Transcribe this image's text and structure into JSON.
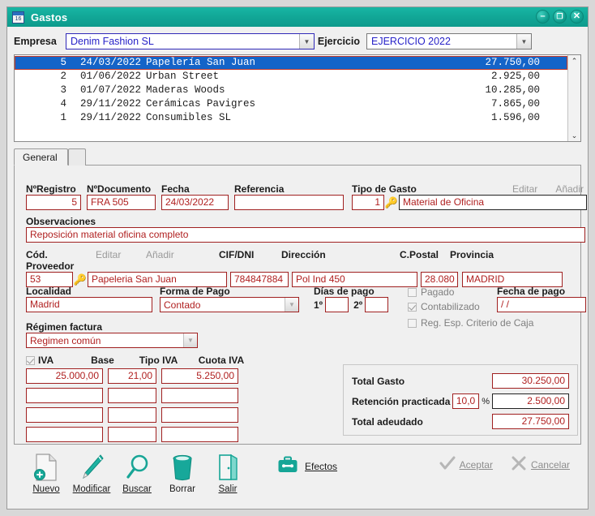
{
  "window": {
    "title": "Gastos",
    "icon": "calendar-16-icon",
    "icon_text": "16",
    "buttons": {
      "minimize": "–",
      "maximize": "❐",
      "close": "✕"
    }
  },
  "header": {
    "empresa_label": "Empresa",
    "empresa_value": "Denim Fashion SL",
    "ejercicio_label": "Ejercicio",
    "ejercicio_value": "EJERCICIO 2022"
  },
  "list": {
    "rows": [
      {
        "num": "5",
        "date": "24/03/2022",
        "name": "Papelería San Juan",
        "amount": "27.750,00",
        "selected": true
      },
      {
        "num": "2",
        "date": "01/06/2022",
        "name": "Urban Street",
        "amount": "2.925,00",
        "selected": false
      },
      {
        "num": "3",
        "date": "01/07/2022",
        "name": "Maderas Woods",
        "amount": "10.285,00",
        "selected": false
      },
      {
        "num": "4",
        "date": "29/11/2022",
        "name": "Cerámicas Pavigres",
        "amount": "7.865,00",
        "selected": false
      },
      {
        "num": "1",
        "date": "29/11/2022",
        "name": "Consumibles SL",
        "amount": "1.596,00",
        "selected": false
      }
    ],
    "scroll_up": "⌃",
    "scroll_down": "⌄"
  },
  "tabs": {
    "general": "General"
  },
  "form": {
    "nregistro_label": "NºRegistro",
    "nregistro_value": "5",
    "ndocumento_label": "NºDocumento",
    "ndocumento_value": "FRA 505",
    "fecha_label": "Fecha",
    "fecha_value": "24/03/2022",
    "referencia_label": "Referencia",
    "referencia_value": "",
    "tipogasto_label": "Tipo de Gasto",
    "tipogasto_code": "1",
    "tipogasto_value": "Material de Oficina",
    "tipogasto_editar": "Editar",
    "tipogasto_anadir": "Añadir",
    "observaciones_label": "Observaciones",
    "observaciones_value": "Reposición material oficina completo",
    "proveedor_label": "Cód. Proveedor",
    "proveedor_code": "53",
    "proveedor_value": "Papeleria San Juan",
    "proveedor_editar": "Editar",
    "proveedor_anadir": "Añadir",
    "cifdni_label": "CIF/DNI",
    "cifdni_value": "784847884",
    "direccion_label": "Dirección",
    "direccion_value": "Pol Ind 450",
    "cpostal_label": "C.Postal",
    "cpostal_value": "28.080",
    "provincia_label": "Provincia",
    "provincia_value": "MADRID",
    "localidad_label": "Localidad",
    "localidad_value": "Madrid",
    "formapago_label": "Forma de Pago",
    "formapago_value": "Contado",
    "diaspago_label": "Días de pago",
    "diaspago_1_label": "1º",
    "diaspago_1_value": "",
    "diaspago_2_label": "2º",
    "diaspago_2_value": "",
    "pagado_label": "Pagado",
    "pagado_checked": false,
    "contabilizado_label": "Contabilizado",
    "contabilizado_checked": true,
    "regespcaja_label": "Reg. Esp. Criterio de Caja",
    "regespcaja_checked": false,
    "fechapago_label": "Fecha de pago",
    "fechapago_value": "/ /",
    "regimen_label": "Régimen factura",
    "regimen_value": "Regimen común",
    "iva_label": "IVA",
    "iva_checked": true,
    "base_label": "Base",
    "tipoiva_label": "Tipo IVA",
    "cuotaiva_label": "Cuota IVA",
    "iva_rows": [
      {
        "base": "25.000,00",
        "tipo": "21,00",
        "cuota": "5.250,00"
      },
      {
        "base": "",
        "tipo": "",
        "cuota": ""
      },
      {
        "base": "",
        "tipo": "",
        "cuota": ""
      },
      {
        "base": "",
        "tipo": "",
        "cuota": ""
      }
    ],
    "total_gasto_label": "Total Gasto",
    "total_gasto_value": "30.250,00",
    "retencion_label": "Retención practicada",
    "retencion_pct": "10,0",
    "retencion_pct_symbol": "%",
    "retencion_value": "2.500,00",
    "total_adeudado_label": "Total adeudado",
    "total_adeudado_value": "27.750,00"
  },
  "toolbar": {
    "nuevo": "Nuevo",
    "modificar": "Modificar",
    "buscar": "Buscar",
    "borrar": "Borrar",
    "salir": "Salir",
    "efectos": "Efectos",
    "aceptar": "Aceptar",
    "cancelar": "Cancelar"
  },
  "colors": {
    "titlebar": "#12a898",
    "field_border": "#a02020",
    "field_text": "#b02020",
    "selection": "#1464c8",
    "accent": "#0e9a8c"
  }
}
